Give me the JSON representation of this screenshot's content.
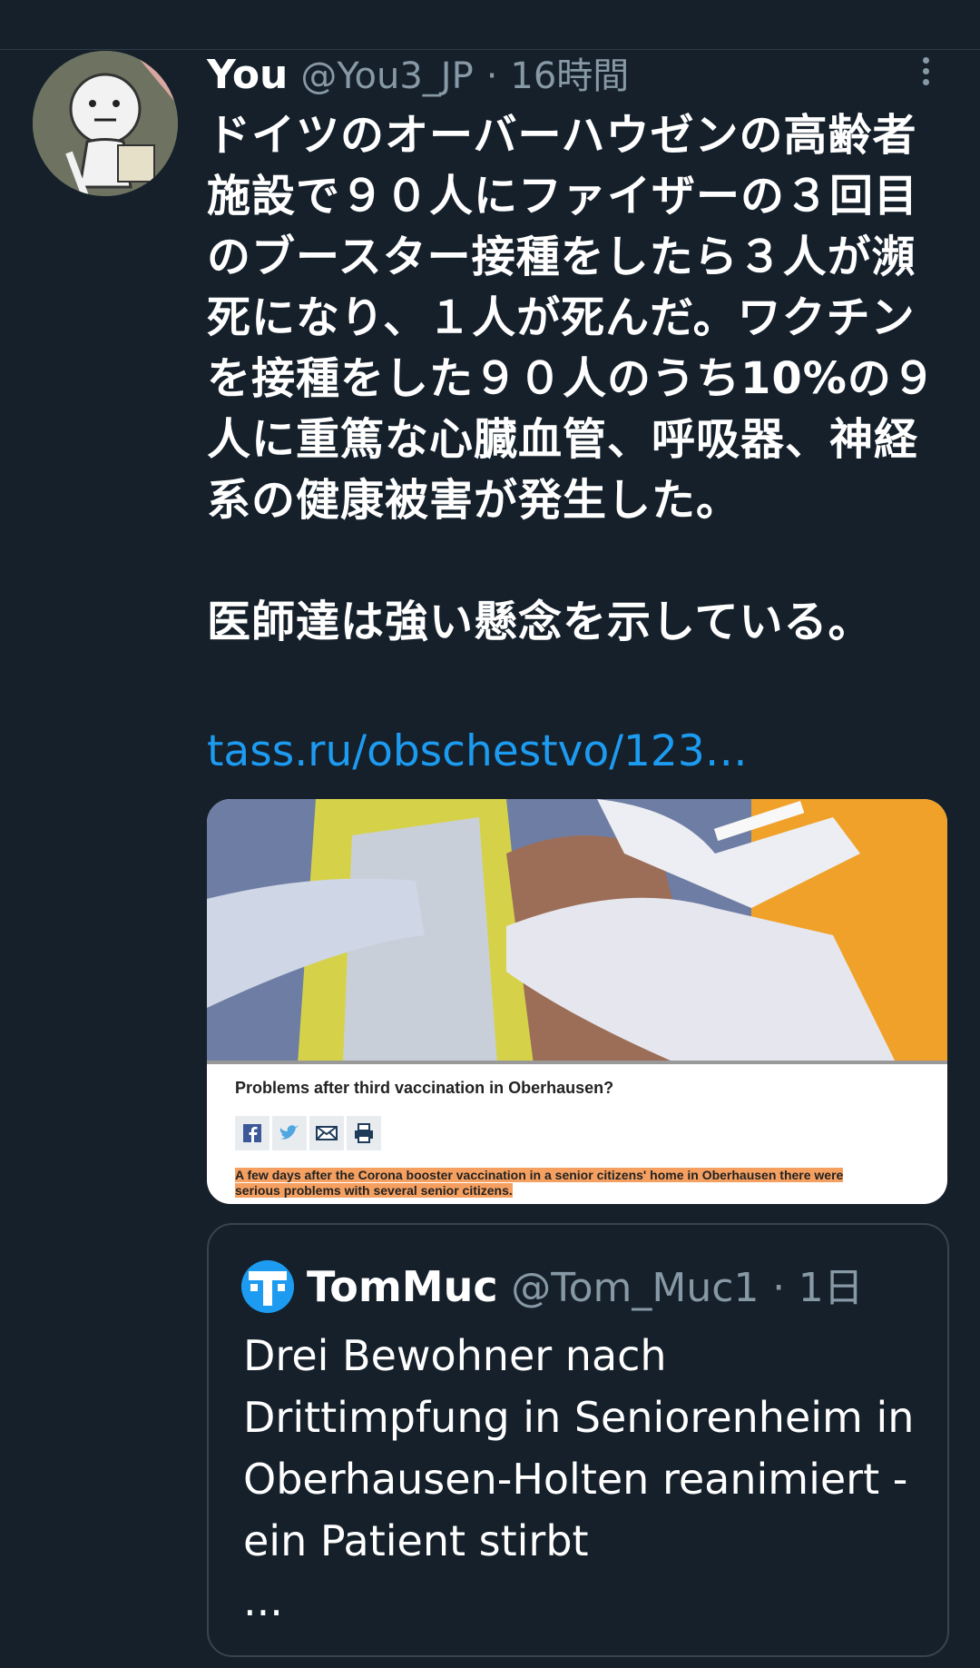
{
  "tweet": {
    "name": "You",
    "handle": "@You3_JP",
    "separator": "·",
    "time": "16時間",
    "text": "ドイツのオーバーハウゼンの高齢者施設で９０人にファイザーの３回目のブースター接種をしたら３人が瀕死になり、１人が死んだ。ワクチンを接種をした９０人のうち10%の９人に重篤な心臓血管、呼吸器、神経系の健康被害が発生した。\n\n医師達は強い懸念を示している。",
    "link": "tass.ru/obschestvo/123…"
  },
  "card": {
    "title": "Problems after third vaccination in Oberhausen?",
    "highlight": "A few days after the Corona booster vaccination in a senior citizens' home in Oberhausen there were serious problems with several senior citizens.",
    "share_icons": [
      "facebook-icon",
      "twitter-icon",
      "mail-icon",
      "print-icon"
    ]
  },
  "quoted": {
    "name": "TomMuc",
    "handle": "@Tom_Muc1",
    "separator": "·",
    "time": "1日",
    "text": "Drei Bewohner nach Drittimpfung in Seniorenheim in Oberhausen-Holten reanimiert - ein Patient stirbt",
    "ellipsis": "..."
  },
  "colors": {
    "background": "#15202b",
    "link": "#1d9bf0",
    "secondary": "#8899a6",
    "highlight": "#f5a060"
  }
}
